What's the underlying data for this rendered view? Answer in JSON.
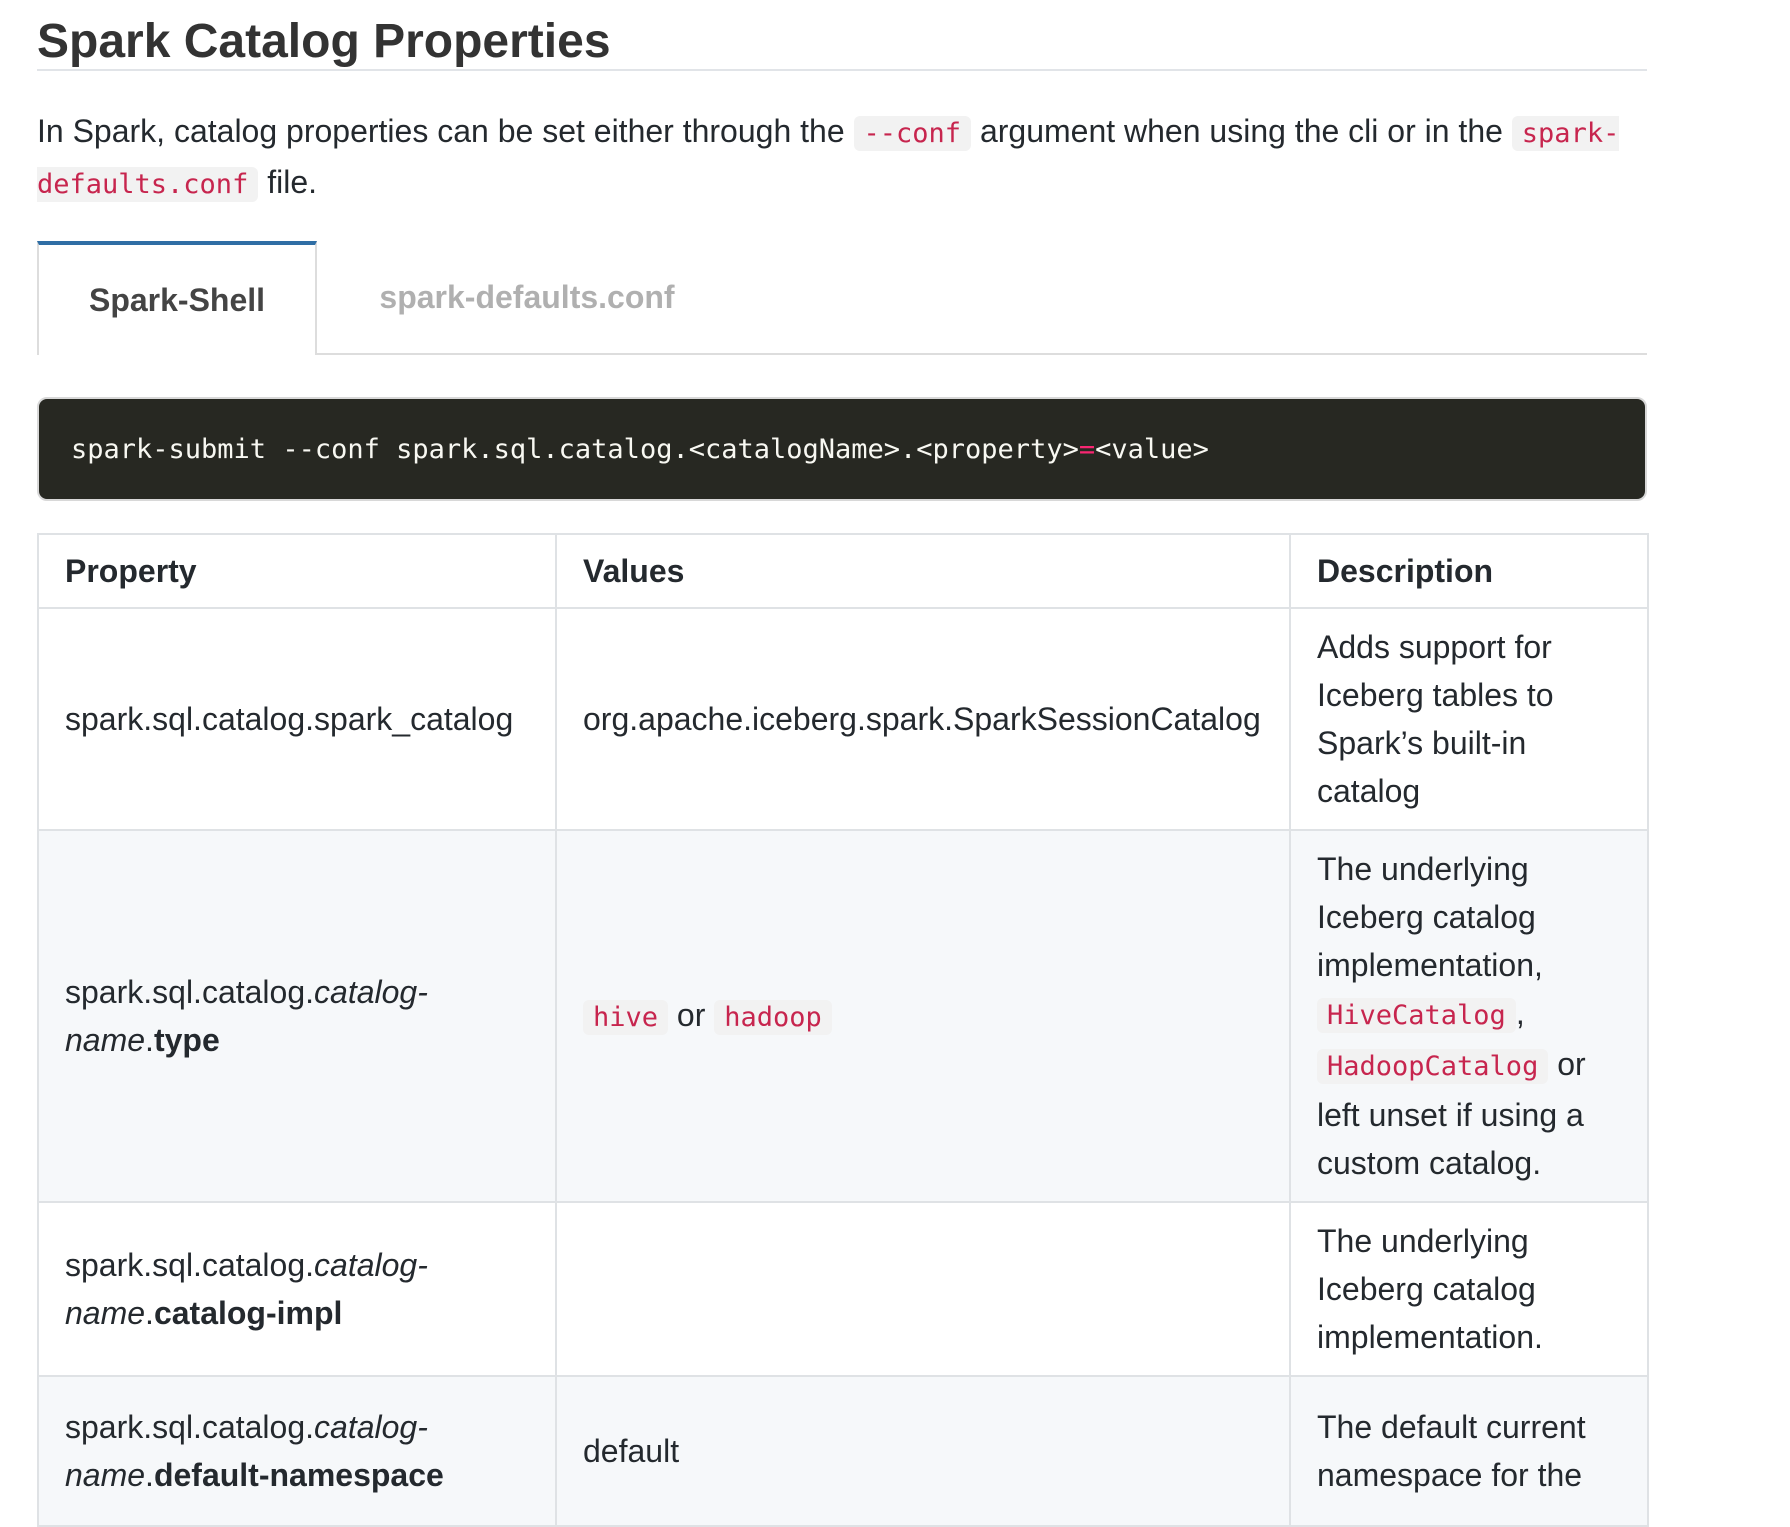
{
  "heading": "Spark Catalog Properties",
  "intro": {
    "text_before": "In Spark, catalog properties can be set either through the ",
    "code_conf": "--conf",
    "text_middle": " argument when using the cli or in the ",
    "code_file": "spark-defaults.conf",
    "text_after": " file."
  },
  "tabs": [
    {
      "label": "Spark-Shell",
      "active": true
    },
    {
      "label": "spark-defaults.conf",
      "active": false
    }
  ],
  "code_example": {
    "before": "spark-submit --conf spark.sql.catalog.<catalogName>.<property>",
    "operator": "=",
    "after": "<value>"
  },
  "table": {
    "headers": [
      "Property",
      "Values",
      "Description"
    ],
    "rows": [
      {
        "prop_prefix": "spark.sql.catalog.spark_catalog",
        "prop_em": "",
        "prop_strong": "",
        "values_text": "org.apache.iceberg.spark.SparkSessionCatalog",
        "desc": "Adds support for Iceberg tables to Spark’s built-in catalog"
      },
      {
        "prop_prefix": "spark.sql.catalog.",
        "prop_em": "catalog-name",
        "prop_dot": ".",
        "prop_strong": "type",
        "values_code1": "hive",
        "values_or": " or ",
        "values_code2": "hadoop",
        "desc_before": "The underlying Iceberg catalog implementation, ",
        "desc_code1": "HiveCatalog",
        "desc_comma": ", ",
        "desc_code2": "HadoopCatalog",
        "desc_after": " or left unset if using a custom catalog."
      },
      {
        "prop_prefix": "spark.sql.catalog.",
        "prop_em": "catalog-name",
        "prop_dot": ".",
        "prop_strong": "catalog-impl",
        "values_text": "",
        "desc": "The underlying Iceberg catalog implementation."
      },
      {
        "prop_prefix": "spark.sql.catalog.",
        "prop_em": "catalog-name",
        "prop_dot": ".",
        "prop_strong": "default-namespace",
        "values_text": "default",
        "desc": "The default current namespace for the"
      }
    ]
  }
}
